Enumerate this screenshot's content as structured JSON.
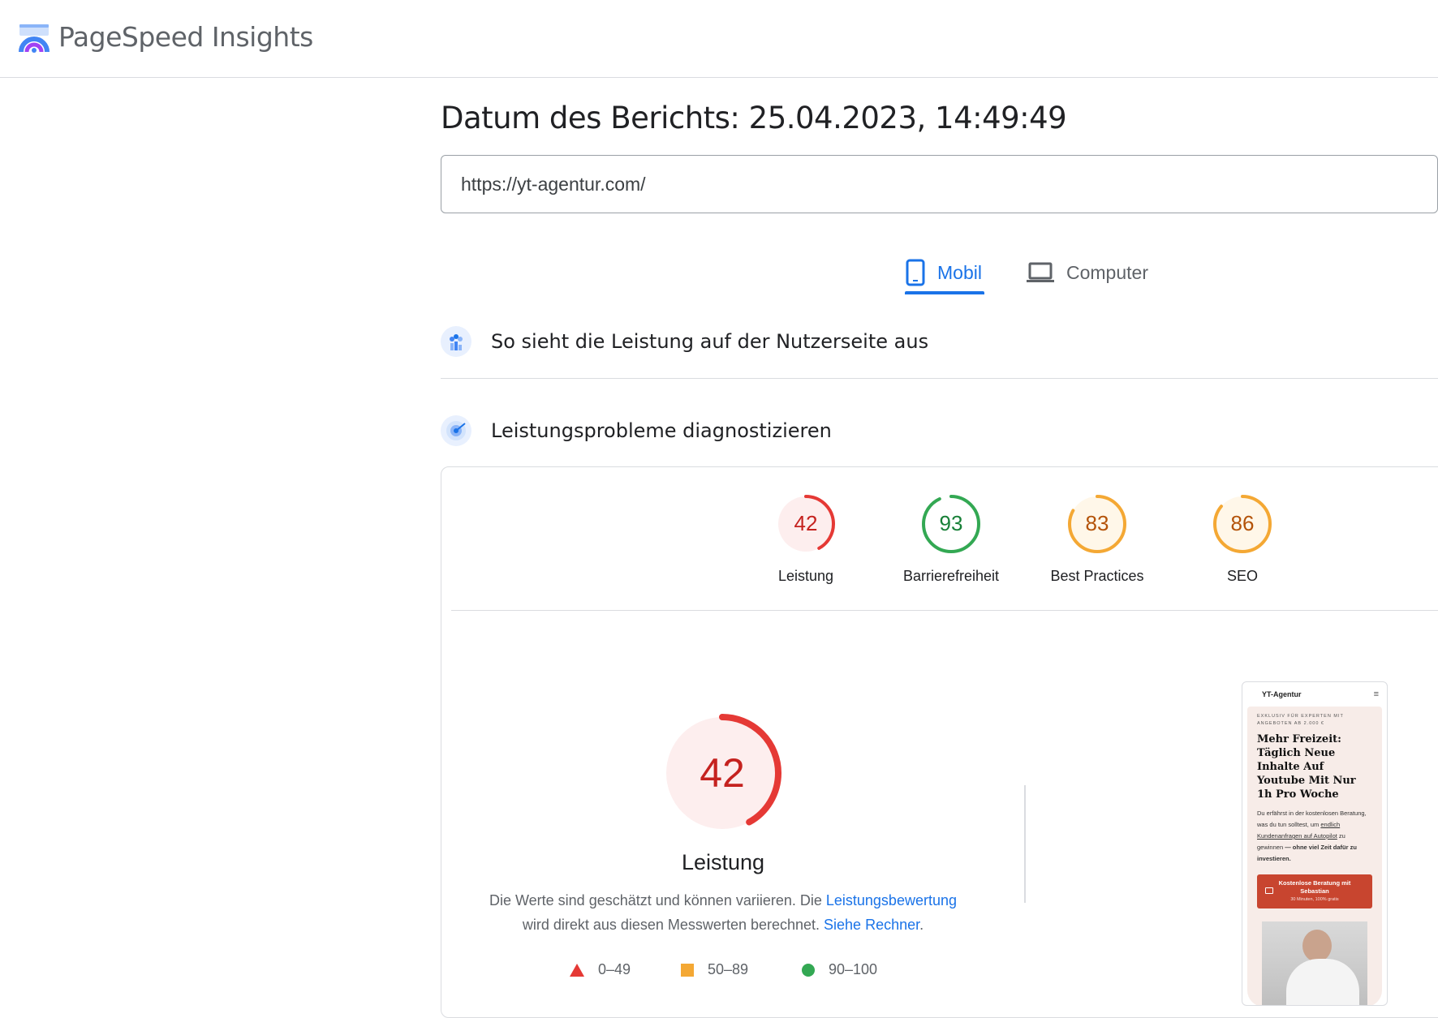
{
  "header": {
    "app_title": "PageSpeed Insights"
  },
  "report": {
    "date_label": "Datum des Berichts: 25.04.2023, 14:49:49"
  },
  "url_input": {
    "value": "https://yt-agentur.com/"
  },
  "tabs": [
    {
      "label": "Mobil",
      "selected": true
    },
    {
      "label": "Computer",
      "selected": false
    }
  ],
  "sections": {
    "field_data": "So sieht die Leistung auf der Nutzerseite aus",
    "diagnose": "Leistungsprobleme diagnostizieren"
  },
  "scores": [
    {
      "label": "Leistung",
      "value": 42,
      "color": "#e53935",
      "bg": "#fdeeee"
    },
    {
      "label": "Barrierefreiheit",
      "value": 93,
      "color": "#33a853",
      "bg": "#ffffff"
    },
    {
      "label": "Best Practices",
      "value": 83,
      "color": "#f4a834",
      "bg": "#fff7e9"
    },
    {
      "label": "SEO",
      "value": 86,
      "color": "#f4a834",
      "bg": "#fff7e9"
    }
  ],
  "performance": {
    "score": 42,
    "title": "Leistung",
    "desc_part1": "Die Werte sind geschätzt und können variieren. Die ",
    "link1": "Leistungsbewertung",
    "desc_part2": " wird direkt aus diesen Messwerten berechnet. ",
    "link2": "Siehe Rechner",
    "desc_end": "."
  },
  "legend": [
    {
      "range": "0–49",
      "shape": "triangle",
      "color": "#e53935"
    },
    {
      "range": "50–89",
      "shape": "square",
      "color": "#f4a834"
    },
    {
      "range": "90–100",
      "shape": "circle",
      "color": "#33a853"
    }
  ],
  "preview": {
    "brand": "YT-Agentur",
    "eyebrow": "Exklusiv für Experten mit Angeboten ab 2.000 €",
    "headline": "Mehr Freizeit: Täglich Neue Inhalte Auf Youtube Mit Nur 1h Pro Woche",
    "text_a": "Du erfährst in der kostenlosen Beratung, was du tun solltest, um ",
    "text_link": "endlich Kundenanfragen auf Autopilot",
    "text_b": " zu gewinnen ",
    "text_bold": "— ohne viel Zeit dafür zu investieren.",
    "cta": "Kostenlose Beratung mit Sebastian",
    "cta_sub": "30 Minuten, 100% gratis"
  }
}
